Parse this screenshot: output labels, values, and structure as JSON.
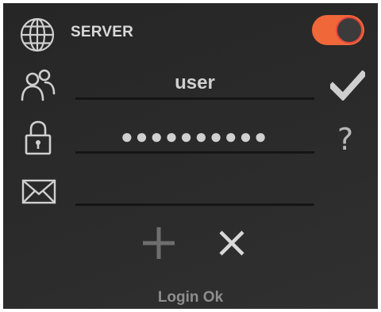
{
  "server": {
    "label": "SERVER",
    "toggle_on": true,
    "toggle_color": "#f0673a"
  },
  "icons": {
    "server": "globe-icon",
    "user": "users-icon",
    "password": "lock-icon",
    "email": "envelope-icon",
    "confirm": "checkmark-icon",
    "help": "question-icon",
    "add": "plus-icon",
    "cancel": "close-icon"
  },
  "form": {
    "username_value": "user",
    "password_value": "●●●●●●●●●●",
    "email_value": "",
    "help_label": "?"
  },
  "status": {
    "text": "Login Ok"
  }
}
